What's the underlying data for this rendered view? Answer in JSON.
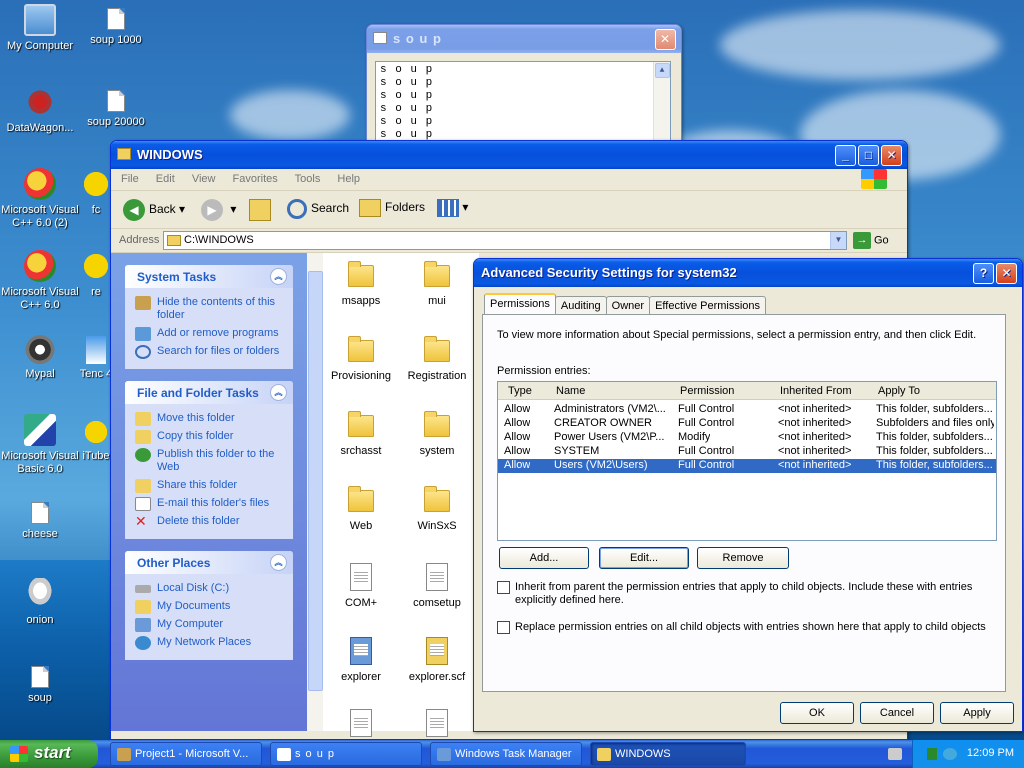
{
  "desktop": {
    "icons": [
      {
        "label": "My Computer"
      },
      {
        "label": "soup 1000"
      },
      {
        "label": "DataWagon..."
      },
      {
        "label": "soup 20000"
      },
      {
        "label": "Microsoft Visual C++ 6.0 (2)"
      },
      {
        "label": "fc"
      },
      {
        "label": "Microsoft Visual C++ 6.0"
      },
      {
        "label": "re"
      },
      {
        "label": "Mypal"
      },
      {
        "label": "Tenc 4"
      },
      {
        "label": "Microsoft Visual Basic 6.0"
      },
      {
        "label": "iTube"
      },
      {
        "label": "cheese"
      },
      {
        "label": "onion"
      },
      {
        "label": "soup"
      }
    ]
  },
  "soup_window": {
    "title": "s o u p",
    "lines": [
      "s o u p",
      "s o u p",
      "s o u p",
      "s o u p",
      "s o u p",
      "s o u p"
    ]
  },
  "explorer": {
    "title": "WINDOWS",
    "menu": [
      "File",
      "Edit",
      "View",
      "Favorites",
      "Tools",
      "Help"
    ],
    "toolbar": {
      "back": "Back",
      "search": "Search",
      "folders": "Folders"
    },
    "address_label": "Address",
    "address_value": "C:\\WINDOWS",
    "go": "Go",
    "system_tasks": {
      "title": "System Tasks",
      "items": [
        "Hide the contents of this folder",
        "Add or remove programs",
        "Search for files or folders"
      ]
    },
    "file_folder_tasks": {
      "title": "File and Folder Tasks",
      "items": [
        "Move this folder",
        "Copy this folder",
        "Publish this folder to the Web",
        "Share this folder",
        "E-mail this folder's files",
        "Delete this folder"
      ]
    },
    "other_places": {
      "title": "Other Places",
      "items": [
        "Local Disk (C:)",
        "My Documents",
        "My Computer",
        "My Network Places"
      ]
    },
    "files": [
      "msapps",
      "mui",
      "Provisioning",
      "Registration",
      "srchasst",
      "system",
      "Web",
      "WinSxS",
      "COM+",
      "comsetup",
      "explorer",
      "explorer.scf"
    ]
  },
  "dialog": {
    "title": "Advanced Security Settings for system32",
    "tabs": [
      "Permissions",
      "Auditing",
      "Owner",
      "Effective Permissions"
    ],
    "description": "To view more information about Special permissions, select a permission entry, and then click Edit.",
    "entries_label": "Permission entries:",
    "columns": [
      "Type",
      "Name",
      "Permission",
      "Inherited From",
      "Apply To"
    ],
    "rows": [
      [
        "Allow",
        "Administrators (VM2\\...",
        "Full Control",
        "<not inherited>",
        "This folder, subfolders..."
      ],
      [
        "Allow",
        "CREATOR OWNER",
        "Full Control",
        "<not inherited>",
        "Subfolders and files only"
      ],
      [
        "Allow",
        "Power Users (VM2\\P...",
        "Modify",
        "<not inherited>",
        "This folder, subfolders..."
      ],
      [
        "Allow",
        "SYSTEM",
        "Full Control",
        "<not inherited>",
        "This folder, subfolders..."
      ],
      [
        "Allow",
        "Users (VM2\\Users)",
        "Full Control",
        "<not inherited>",
        "This folder, subfolders..."
      ]
    ],
    "buttons": {
      "add": "Add...",
      "edit": "Edit...",
      "remove": "Remove",
      "ok": "OK",
      "cancel": "Cancel",
      "apply": "Apply"
    },
    "inherit_label": "Inherit from parent the permission entries that apply to child objects. Include these with entries explicitly defined here.",
    "replace_label": "Replace permission entries on all child objects with entries shown here that apply to child objects"
  },
  "taskbar": {
    "start": "start",
    "tasks": [
      "Project1 - Microsoft V...",
      "s o u p",
      "Windows Task Manager",
      "WINDOWS"
    ],
    "clock": "12:09 PM"
  }
}
